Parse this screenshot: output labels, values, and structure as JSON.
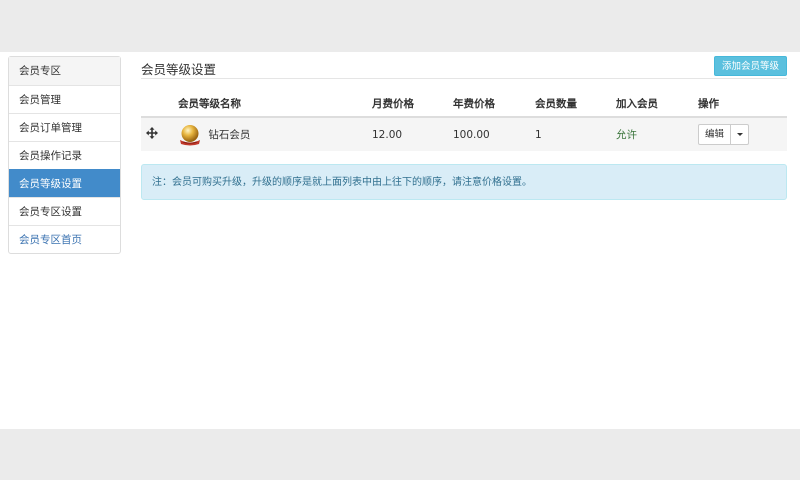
{
  "sidebar": {
    "items": [
      {
        "label": "会员专区"
      },
      {
        "label": "会员管理"
      },
      {
        "label": "会员订单管理"
      },
      {
        "label": "会员操作记录"
      },
      {
        "label": "会员等级设置"
      },
      {
        "label": "会员专区设置"
      },
      {
        "label": "会员专区首页"
      }
    ],
    "active_index": 4
  },
  "header": {
    "title": "会员等级设置",
    "add_button_label": "添加会员等级"
  },
  "table": {
    "columns": [
      "会员等级名称",
      "月费价格",
      "年费价格",
      "会员数量",
      "加入会员",
      "操作"
    ],
    "rows": [
      {
        "icon": "gold-medal-icon",
        "name": "钻石会员",
        "monthly_price": "12.00",
        "yearly_price": "100.00",
        "member_count": "1",
        "join_status": "允许",
        "edit_label": "编辑"
      }
    ]
  },
  "notice": {
    "text": "注：会员可购买升级，升级的顺序是就上面列表中由上往下的顺序，请注意价格设置。"
  },
  "colors": {
    "accent": "#428bca",
    "info_button": "#5bc0de",
    "notice_bg": "#d9edf7",
    "success_text": "#3c763d"
  }
}
